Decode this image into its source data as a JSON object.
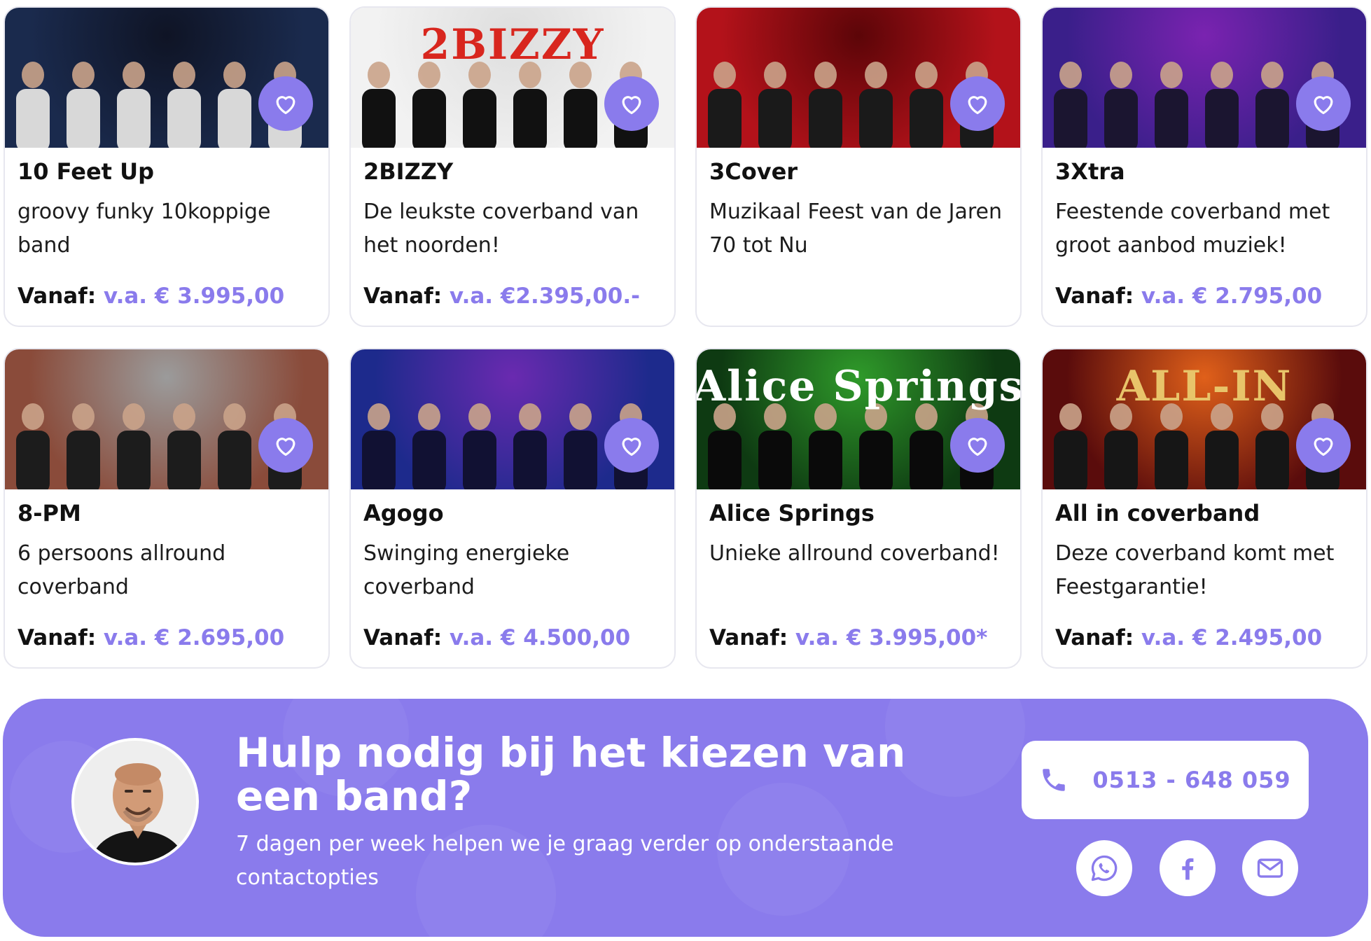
{
  "colors": {
    "accent": "#8a7bec",
    "banner_bg": "#8a7bec",
    "card_border": "#e7e7ef",
    "text": "#111111"
  },
  "price_label": "Vanaf:",
  "favorite_icon": "heart-icon",
  "bands": [
    {
      "name": "10 Feet Up",
      "description": "groovy funky 10koppige band",
      "price": "v.a. € 3.995,00",
      "image_mark": "",
      "image_colors": [
        "#1a2a4d",
        "#0f1425",
        "#d8d8d8"
      ]
    },
    {
      "name": "2BIZZY",
      "description": "De leukste coverband van het noorden!",
      "price": "v.a. €2.395,00.-",
      "image_mark": "2BIZZY",
      "image_colors": [
        "#f2f2f2",
        "#dedede",
        "#111111"
      ]
    },
    {
      "name": "3Cover",
      "description": "Muzikaal Feest van de Jaren 70 tot Nu",
      "price": "",
      "image_mark": "",
      "image_colors": [
        "#b3121a",
        "#5c0508",
        "#1a1a1a"
      ]
    },
    {
      "name": "3Xtra",
      "description": "Feestende coverband met groot aanbod muziek!",
      "price": "v.a. € 2.795,00",
      "image_mark": "",
      "image_colors": [
        "#3a1f8a",
        "#7a23b0",
        "#1b1530"
      ]
    },
    {
      "name": "8-PM",
      "description": "6 persoons allround coverband",
      "price": "v.a. € 2.695,00",
      "image_mark": "",
      "image_colors": [
        "#8a4b3a",
        "#9b9b9b",
        "#1c1c1c"
      ]
    },
    {
      "name": "Agogo",
      "description": "Swinging energieke coverband",
      "price": "v.a. € 4.500,00",
      "image_mark": "",
      "image_colors": [
        "#1d2a8c",
        "#6a2ab0",
        "#111133"
      ]
    },
    {
      "name": "Alice Springs",
      "description": "Unieke allround coverband!",
      "price": "v.a. € 3.995,00*",
      "image_mark": "Alice Springs",
      "image_colors": [
        "#0e3a12",
        "#2f9a2a",
        "#0a0a0a"
      ]
    },
    {
      "name": "All in coverband",
      "description": "Deze coverband komt met Feestgarantie!",
      "price": "v.a. € 2.495,00",
      "image_mark": "ALL-IN",
      "image_colors": [
        "#5a0c0c",
        "#e0601a",
        "#161616"
      ]
    }
  ],
  "help": {
    "title": "Hulp nodig bij het kiezen van een band?",
    "subtitle": "7 dagen per week helpen we je graag verder op onderstaande contactopties",
    "phone_number": "0513 - 648 059",
    "phone_icon": "phone-icon",
    "socials": [
      {
        "name": "whatsapp",
        "icon": "whatsapp-icon"
      },
      {
        "name": "facebook",
        "icon": "facebook-icon"
      },
      {
        "name": "email",
        "icon": "mail-icon"
      }
    ]
  }
}
